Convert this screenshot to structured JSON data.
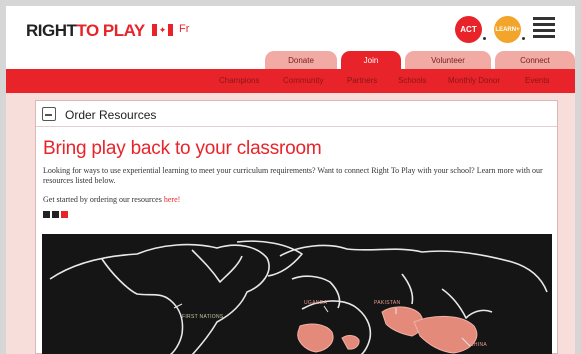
{
  "header": {
    "logo_dark": "RIGHT",
    "logo_red": "TO PLAY",
    "language": "Fr",
    "act_label": "ACT",
    "learn_label": "LEARN+"
  },
  "tabs": [
    {
      "label": "Donate",
      "active": false
    },
    {
      "label": "Join",
      "active": true
    },
    {
      "label": "Volunteer",
      "active": false
    },
    {
      "label": "Connect",
      "active": false
    }
  ],
  "subnav": [
    "Champions",
    "Community",
    "Partners",
    "Schools",
    "Monthly Donor",
    "Events"
  ],
  "card": {
    "title": "Order Resources",
    "headline": "Bring play back to your classroom",
    "paragraph": "Looking for ways to use experiential learning to meet your curriculum requirements? Want to connect Right To Play with your school? Learn more with our resources listed below.",
    "cta_prefix": "Get started by ordering our resources ",
    "cta_link": "here!"
  },
  "map_labels": {
    "first_nations": "FIRST NATIONS",
    "uganda": "UGANDA",
    "pakistan": "PAKISTAN",
    "china": "CHINA"
  },
  "colors": {
    "brand_red": "#e8242a",
    "learn_orange": "#f3a52b",
    "tab_inactive": "#f1aaa4",
    "page_tint": "#f7dedb"
  },
  "icons": [
    "canada-flag-icon",
    "menu-icon",
    "document-icon",
    "twitter-icon",
    "facebook-icon",
    "youtube-icon"
  ]
}
